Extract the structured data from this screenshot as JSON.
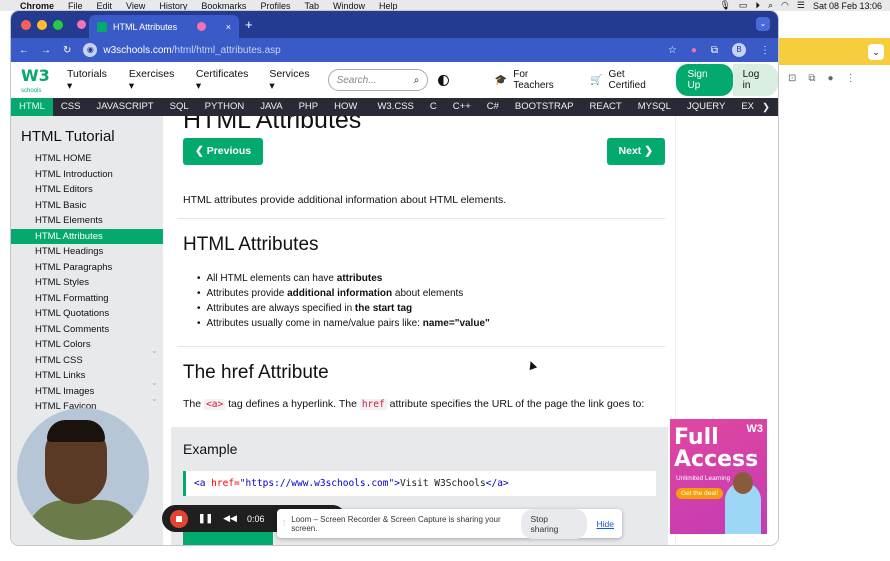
{
  "macos": {
    "app_name": "Chrome",
    "menus": [
      "File",
      "Edit",
      "View",
      "History",
      "Bookmarks",
      "Profiles",
      "Tab",
      "Window",
      "Help"
    ],
    "clock": "Sat 08 Feb 13:06"
  },
  "browser": {
    "tab_title": "HTML Attributes",
    "tab_close": "×",
    "new_tab": "+",
    "url_host": "w3schools.com",
    "url_path": "/html/html_attributes.asp",
    "profile_initial": "B"
  },
  "w3header": {
    "logo_text": "W3",
    "logo_sub": "schools",
    "nav": [
      "Tutorials ▾",
      "Exercises ▾",
      "Certificates ▾",
      "Services ▾"
    ],
    "search_placeholder": "Search...",
    "for_teachers": "For Teachers",
    "get_certified": "Get Certified",
    "sign_up": "Sign Up",
    "log_in": "Log in"
  },
  "langnav": {
    "items": [
      "HTML",
      "CSS",
      "JAVASCRIPT",
      "SQL",
      "PYTHON",
      "JAVA",
      "PHP",
      "HOW TO",
      "W3.CSS",
      "C",
      "C++",
      "C#",
      "BOOTSTRAP",
      "REACT",
      "MYSQL",
      "JQUERY",
      "EX"
    ],
    "active": "HTML"
  },
  "sidebar": {
    "title": "HTML Tutorial",
    "links": [
      "HTML HOME",
      "HTML Introduction",
      "HTML Editors",
      "HTML Basic",
      "HTML Elements",
      "HTML Attributes",
      "HTML Headings",
      "HTML Paragraphs",
      "HTML Styles",
      "HTML Formatting",
      "HTML Quotations",
      "HTML Comments",
      "HTML Colors",
      "HTML CSS",
      "HTML Links",
      "HTML Images",
      "HTML Favicon"
    ],
    "active": "HTML Attributes"
  },
  "main": {
    "page_title": "HTML Attributes",
    "prev_label": "❮ Previous",
    "next_label": "Next ❯",
    "intro": "HTML attributes provide additional information about HTML elements.",
    "section1_title": "HTML Attributes",
    "bullets": [
      {
        "pre": "All HTML elements can have ",
        "bold": "attributes",
        "post": ""
      },
      {
        "pre": "Attributes provide ",
        "bold": "additional information",
        "post": " about elements"
      },
      {
        "pre": "Attributes are always specified in ",
        "bold": "the start tag",
        "post": ""
      },
      {
        "pre": "Attributes usually come in name/value pairs like: ",
        "bold": "name=\"value\"",
        "post": ""
      }
    ],
    "section2_title": "The href Attribute",
    "href_para": {
      "p1": "The ",
      "code1": "<a>",
      "p2": " tag defines a hyperlink. The ",
      "code2": "href",
      "p3": " attribute specifies the URL of the page the link goes to:"
    },
    "example_title": "Example",
    "example_code": {
      "open_tag": "<a ",
      "attr": "href=",
      "value": "\"https://www.w3schools.com\"",
      "close": ">",
      "text": "Visit W3Schools",
      "end_tag": "</a>"
    }
  },
  "ad": {
    "headline_1": "Full",
    "headline_2": "Access",
    "tagline": "Unlimited Learning",
    "cta": "Get the deal!",
    "brand": "W3"
  },
  "recorder": {
    "timer": "0:06"
  },
  "loom": {
    "message": "Loom – Screen Recorder & Screen Capture is sharing your screen.",
    "stop_label": "Stop sharing",
    "hide_label": "Hide"
  },
  "colors": {
    "w3_green": "#04aa6d",
    "langnav_bg": "#282a35",
    "chrome_tab_bg": "#233c92"
  }
}
